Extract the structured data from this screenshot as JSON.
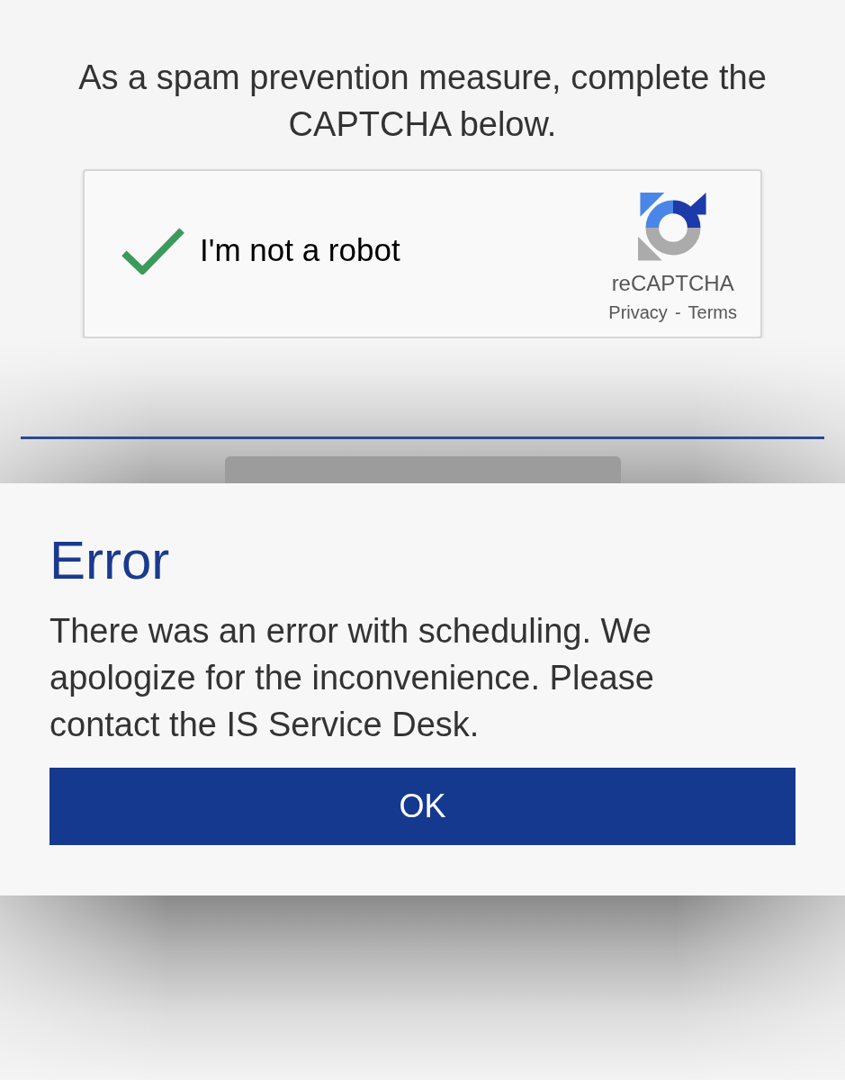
{
  "prompt": {
    "text": "As a spam prevention measure, complete the CAPTCHA below."
  },
  "captcha": {
    "label": "I'm not a robot",
    "checked": true,
    "brand": "reCAPTCHA",
    "links": [
      "Privacy",
      "Terms"
    ],
    "separator": "-"
  },
  "dialog": {
    "title": "Error",
    "message": "There was an error with scheduling. We apologize for the inconvenience. Please contact the IS Service Desk.",
    "button": "OK"
  }
}
